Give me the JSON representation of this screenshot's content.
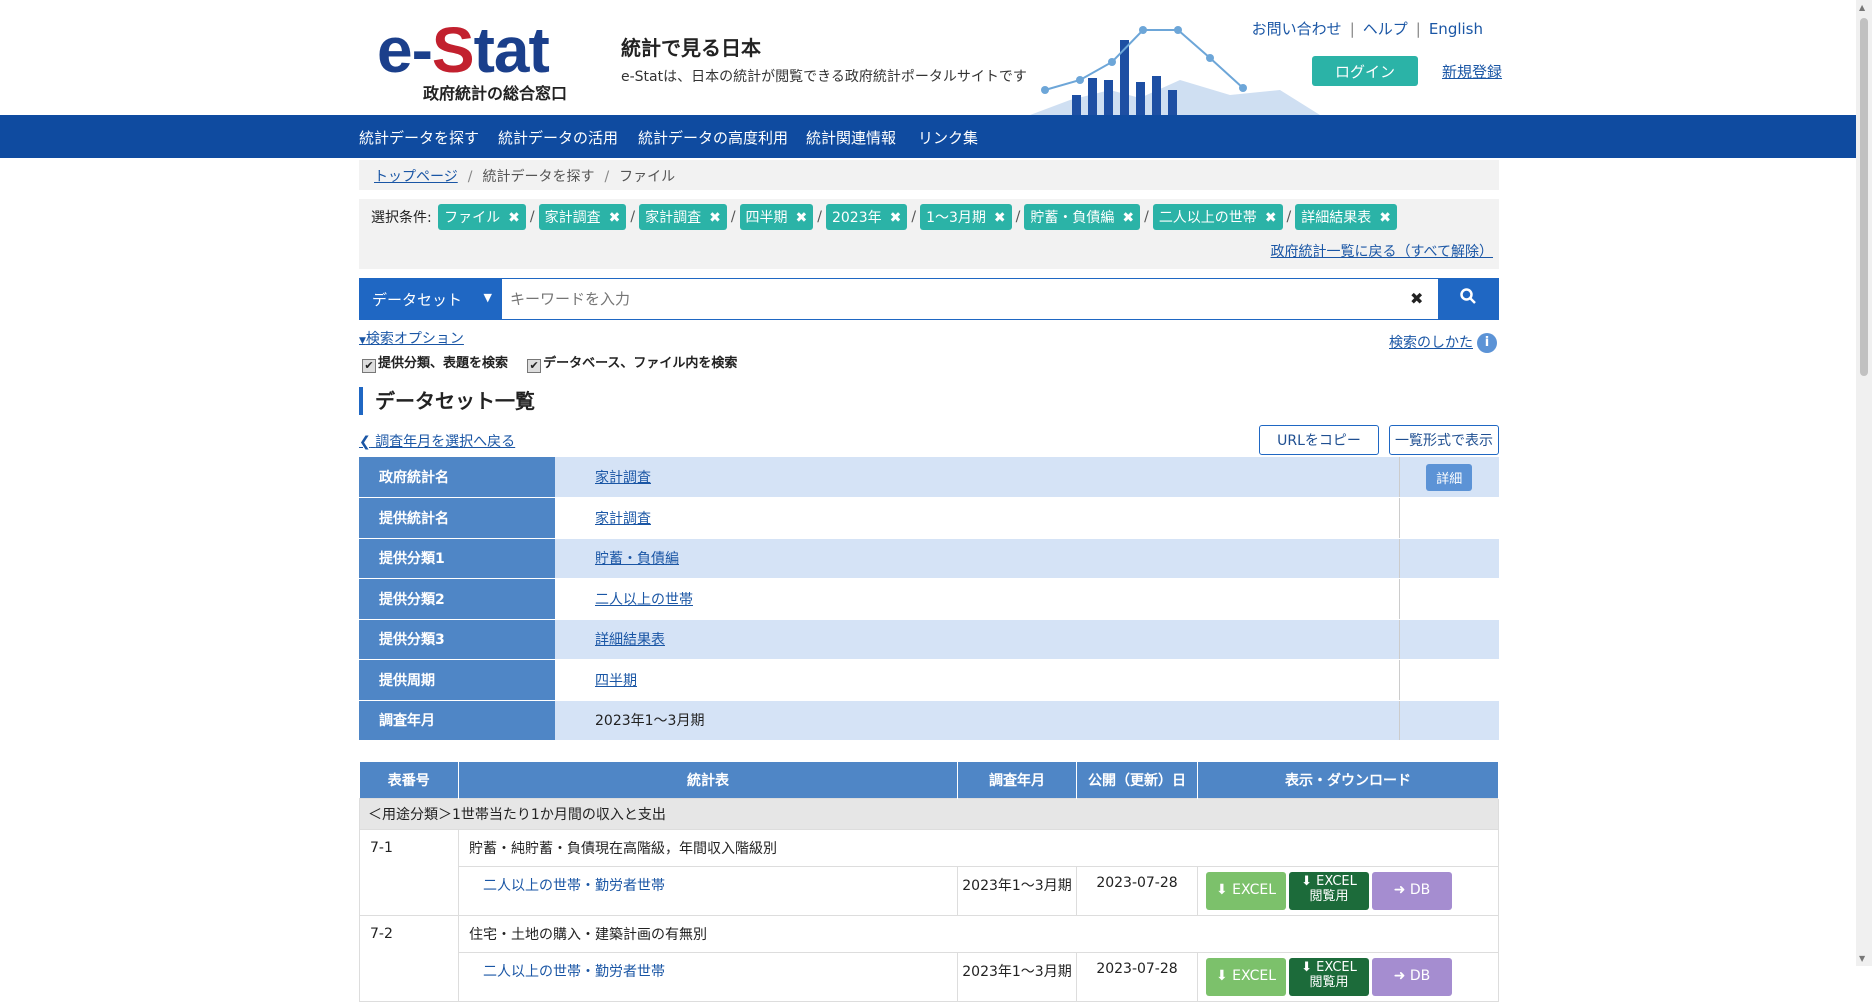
{
  "header": {
    "logo_brand_blue_1": "e-",
    "logo_brand_red": "S",
    "logo_brand_blue_2": "tat",
    "logo_sub": "政府統計の総合窓口",
    "tagline_title": "統計で見る日本",
    "tagline_sub": "e-Statは、日本の統計が閲覧できる政府統計ポータルサイトです",
    "links": [
      "お問い合わせ",
      "ヘルプ",
      "English"
    ],
    "login_label": "ログイン",
    "register_label": "新規登録"
  },
  "nav": {
    "items": [
      "統計データを探す",
      "統計データの活用",
      "統計データの高度利用",
      "統計関連情報",
      "リンク集"
    ]
  },
  "breadcrumb": {
    "items": [
      "トップページ",
      "統計データを探す",
      "ファイル"
    ]
  },
  "conditions": {
    "label": "選択条件:",
    "chips": [
      "ファイル",
      "家計調査",
      "家計調査",
      "四半期",
      "2023年",
      "1～3月期",
      "貯蓄・負債編",
      "二人以上の世帯",
      "詳細結果表"
    ],
    "reset_label": "政府統計一覧に戻る（すべて解除）"
  },
  "search": {
    "type_label": "データセット",
    "placeholder": "キーワードを入力",
    "options_label": "検索オプション",
    "how_label": "検索のしかた",
    "check1": "提供分類、表題を検索",
    "check2": "データベース、ファイル内を検索"
  },
  "section_title": "データセット一覧",
  "back_label": "調査年月を選択へ戻る",
  "copy_url_label": "URLをコピー",
  "list_view_label": "一覧形式で表示",
  "info_table": {
    "detail_label": "詳細",
    "rows": [
      {
        "key": "政府統計名",
        "value": "家計調査"
      },
      {
        "key": "提供統計名",
        "value": "家計調査"
      },
      {
        "key": "提供分類1",
        "value": "貯蓄・負債編"
      },
      {
        "key": "提供分類2",
        "value": "二人以上の世帯"
      },
      {
        "key": "提供分類3",
        "value": "詳細結果表"
      },
      {
        "key": "提供周期",
        "value": "四半期"
      },
      {
        "key": "調査年月",
        "value": "2023年1～3月期"
      }
    ]
  },
  "file_table": {
    "headers": [
      "表番号",
      "統計表",
      "調査年月",
      "公開（更新）日",
      "表示・ダウンロード"
    ],
    "group": "＜用途分類＞1世帯当たり1か月間の収入と支出",
    "rows": [
      {
        "no": "7-1",
        "title": "貯蓄・純貯蓄・負債現在高階級，年間収入階級別",
        "sub": "二人以上の世帯・勤労者世帯",
        "date": "2023年1～3月期",
        "pub": "2023-07-28"
      },
      {
        "no": "7-2",
        "title": "住宅・土地の購入・建築計画の有無別",
        "sub": "二人以上の世帯・勤労者世帯",
        "date": "2023年1～3月期",
        "pub": "2023-07-28"
      }
    ],
    "btn_excel": "EXCEL",
    "btn_view_1": "EXCEL",
    "btn_view_2": "閲覧用",
    "btn_db": "DB"
  },
  "colors": {
    "nav": "#0f4ba0",
    "accent": "#1f67c3",
    "chip": "#2bb3a7",
    "excel": "#7cc16b",
    "excel_view": "#1c6b3a",
    "db": "#a58dd0"
  }
}
